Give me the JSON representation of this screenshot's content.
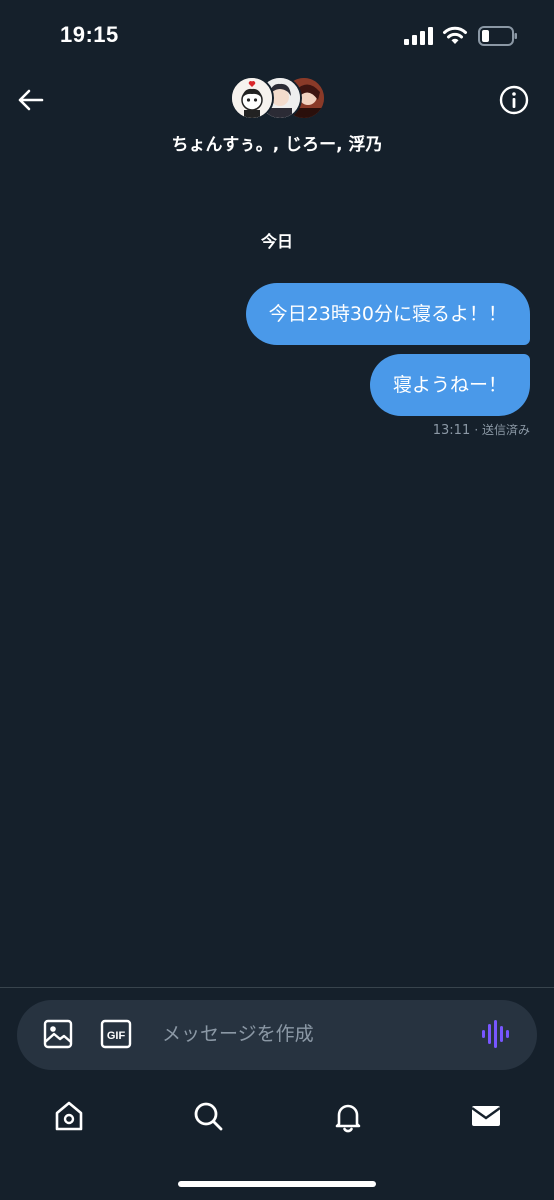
{
  "status_bar": {
    "time": "19:15",
    "icons": [
      "signal-icon",
      "wifi-icon",
      "battery-icon"
    ]
  },
  "header": {
    "group_name": "ちょんすぅ。, じろー, 浮乃",
    "avatars": [
      "avatar-chonsu",
      "avatar-jiro",
      "avatar-ukino"
    ],
    "back_icon": "arrow-left-icon",
    "info_icon": "info-icon"
  },
  "conversation": {
    "date_label": "今日",
    "messages": [
      {
        "text": "今日23時30分に寝るよ！！",
        "direction": "sent"
      },
      {
        "text": "寝ようねー！",
        "direction": "sent"
      }
    ],
    "meta": {
      "time": "13:11",
      "status": "· 送信済み"
    }
  },
  "composer": {
    "placeholder": "メッセージを作成",
    "icons": [
      "image-icon",
      "gif-icon",
      "voice-icon"
    ]
  },
  "tab_bar": {
    "items": [
      "home-icon",
      "search-icon",
      "notifications-icon",
      "messages-icon"
    ]
  },
  "colors": {
    "background": "#15202b",
    "bubble": "#4a99e9",
    "composer": "#273340",
    "muted_text": "#8b98a5",
    "accent_voice": "#7856ff"
  }
}
